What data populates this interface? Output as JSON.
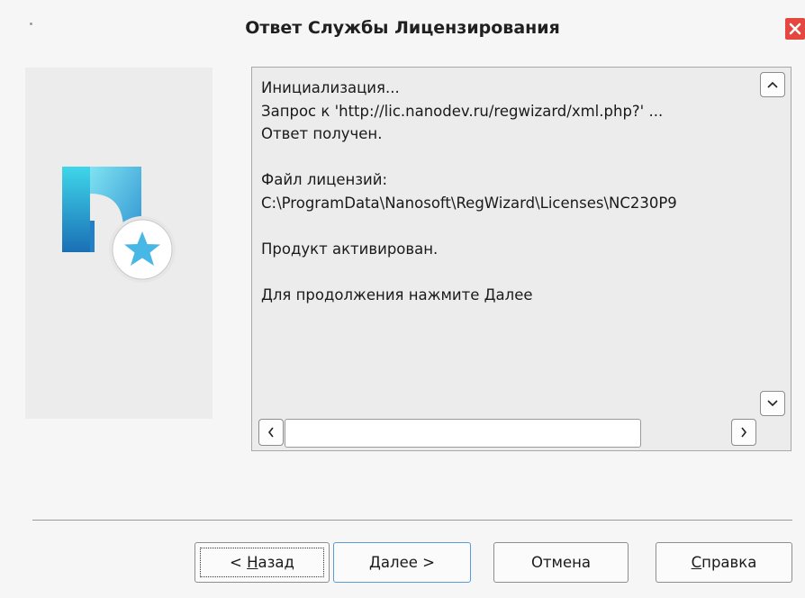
{
  "window": {
    "title": "Ответ Службы Лицензирования",
    "close_label": "✕"
  },
  "log": {
    "lines": [
      "Инициализация...",
      "Запрос к 'http://lic.nanodev.ru/regwizard/xml.php?' ...",
      "Ответ получен.",
      "",
      "Файл лицензий:",
      "C:\\ProgramData\\Nanosoft\\RegWizard\\Licenses\\NC230P9",
      "",
      "Продукт активирован.",
      "",
      "Для продолжения нажмите Далее"
    ]
  },
  "buttons": {
    "back": {
      "prefix": "< ",
      "mnemonic": "Н",
      "rest": "азад"
    },
    "next": {
      "mnemonic": "Д",
      "rest": "алее >"
    },
    "cancel": {
      "label": "Отмена"
    },
    "help": {
      "mnemonic": "С",
      "rest": "правка"
    }
  },
  "icons": {
    "logo": "nanocad-logo-with-star",
    "scroll_up": "chevron-up-icon",
    "scroll_down": "chevron-down-icon",
    "scroll_left": "chevron-left-icon",
    "scroll_right": "chevron-right-icon"
  },
  "colors": {
    "close": "#e5463f",
    "logo_top": "#3fd6ea",
    "logo_bottom": "#1a6fb5",
    "star": "#47b7e6",
    "focus": "#5a9bd6"
  }
}
